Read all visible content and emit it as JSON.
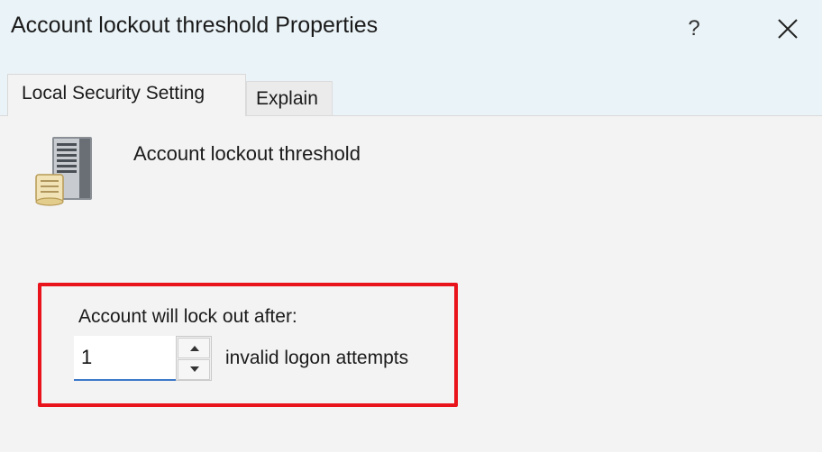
{
  "window": {
    "title": "Account lockout threshold Properties",
    "help_label": "?"
  },
  "tabs": [
    {
      "label": "Local Security Setting",
      "active": true
    },
    {
      "label": "Explain",
      "active": false
    }
  ],
  "policy": {
    "name": "Account lockout threshold",
    "icon": "server-policy-icon"
  },
  "setting": {
    "label": "Account will lock out after:",
    "value": "1",
    "unit_label": "invalid logon attempts"
  },
  "colors": {
    "highlight": "#e8131b",
    "input_focus": "#3b78c8"
  }
}
